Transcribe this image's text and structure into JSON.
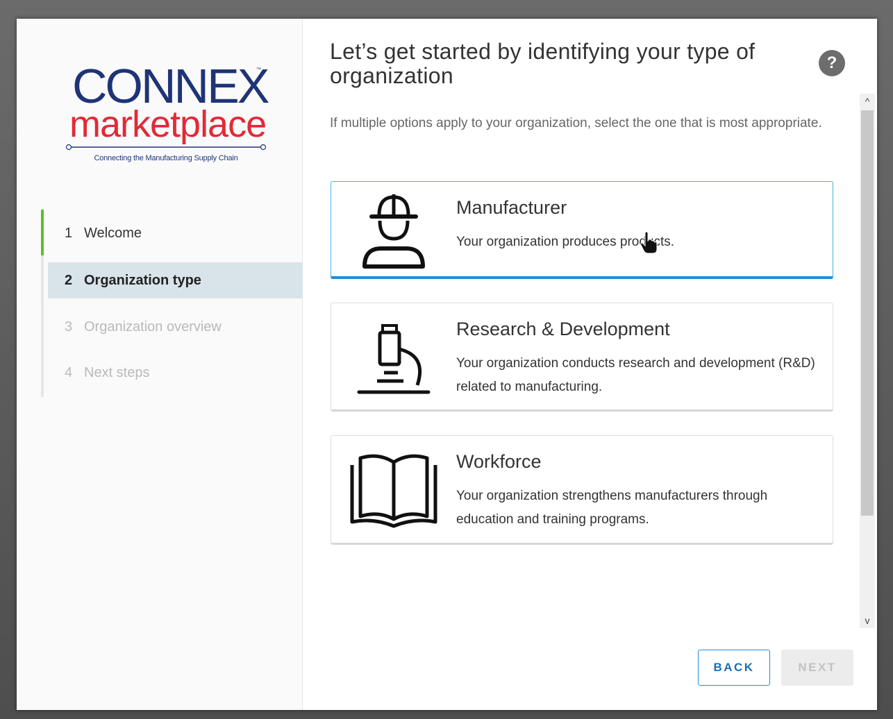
{
  "logo": {
    "brand_top": "CONNEX",
    "trademark": "™",
    "brand_bottom": "marketplace",
    "tagline": "Connecting the Manufacturing Supply Chain"
  },
  "steps": [
    {
      "num": "1",
      "label": "Welcome",
      "state": "done"
    },
    {
      "num": "2",
      "label": "Organization type",
      "state": "active"
    },
    {
      "num": "3",
      "label": "Organization overview",
      "state": "disabled"
    },
    {
      "num": "4",
      "label": "Next steps",
      "state": "disabled"
    }
  ],
  "main": {
    "title": "Let’s get started by identifying your type of organization",
    "help_icon": "?",
    "subtitle": "If multiple options apply to your organization, select the one that is most appropriate."
  },
  "cards": [
    {
      "icon": "worker-hardhat-icon",
      "title": "Manufacturer",
      "description": "Your organization produces products.",
      "selected": true
    },
    {
      "icon": "microscope-icon",
      "title": "Research & Development",
      "description": "Your organization conducts research and development (R&D) related to manufacturing.",
      "selected": false
    },
    {
      "icon": "open-book-icon",
      "title": "Workforce",
      "description": "Your organization strengthens manufacturers through education and training programs.",
      "selected": false
    }
  ],
  "buttons": {
    "back": "BACK",
    "next": "NEXT"
  },
  "scrollbar": {
    "up": "^",
    "down": "v"
  },
  "colors": {
    "accent": "#1d8fd8",
    "step_done": "#5cbf2a",
    "brand_blue": "#1f3476",
    "brand_red": "#e22a36"
  }
}
